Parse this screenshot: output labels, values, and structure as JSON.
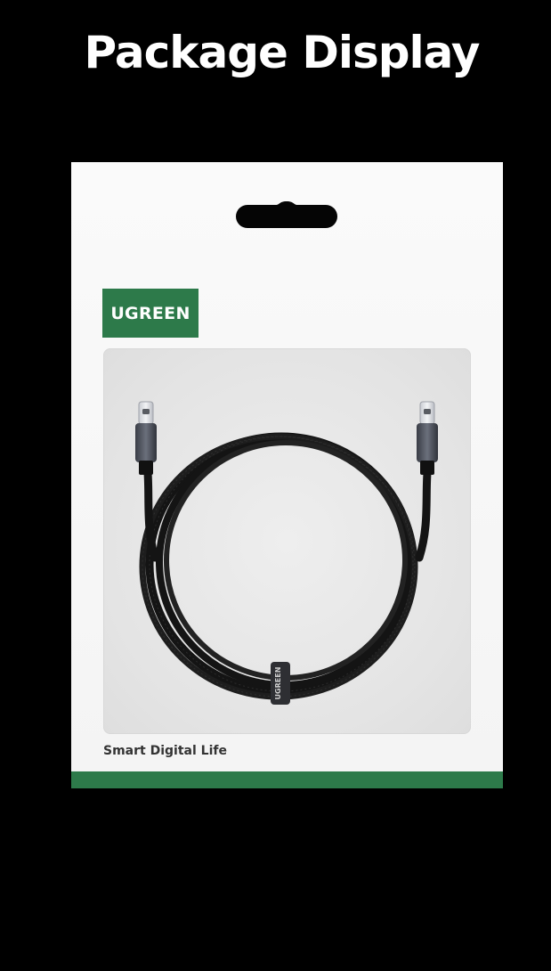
{
  "header": {
    "title": "Package Display"
  },
  "package": {
    "brand": "UGREEN",
    "tagline": "Smart Digital Life",
    "cable_band_label": "UGREEN",
    "colors": {
      "brand_green": "#2d7a4a",
      "box": "#f7f7f7",
      "cable": "#1a1a1a"
    }
  },
  "icons": [
    "usb-c-connector",
    "cable-coil",
    "hang-slot"
  ]
}
